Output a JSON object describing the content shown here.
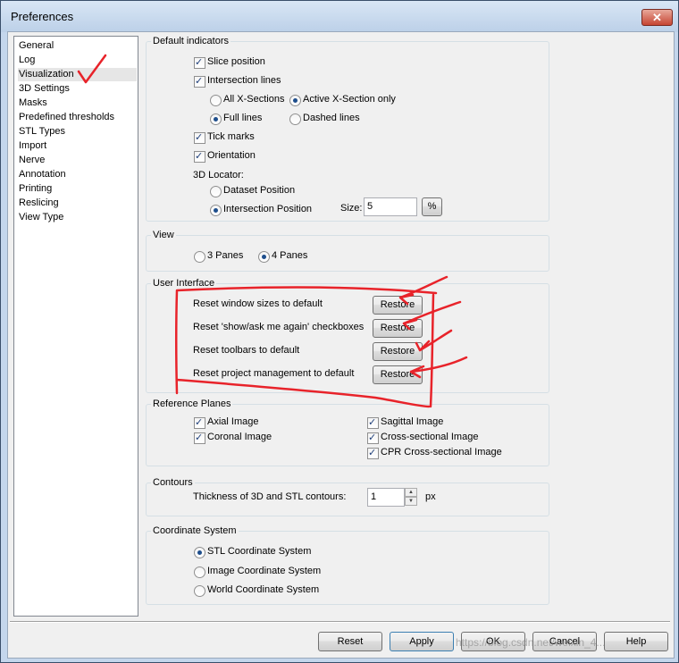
{
  "window": {
    "title": "Preferences",
    "close_symbol": "✕"
  },
  "nav": {
    "items": [
      "General",
      "Log",
      "Visualization",
      "3D Settings",
      "Masks",
      "Predefined thresholds",
      "STL Types",
      "Import",
      "Nerve",
      "Annotation",
      "Printing",
      "Reslicing",
      "View Type"
    ],
    "selected": "Visualization"
  },
  "default_indicators": {
    "title": "Default indicators",
    "slice_position": "Slice position",
    "intersection_lines": "Intersection lines",
    "all_x_sections": "All X-Sections",
    "active_x_section_only": "Active X-Section only",
    "full_lines": "Full lines",
    "dashed_lines": "Dashed lines",
    "tick_marks": "Tick marks",
    "orientation": "Orientation",
    "locator_label": "3D Locator:",
    "dataset_position": "Dataset Position",
    "intersection_position": "Intersection Position",
    "size_label": "Size:",
    "size_value": "5",
    "percent_button": "%"
  },
  "view": {
    "title": "View",
    "three_panes": "3 Panes",
    "four_panes": "4 Panes"
  },
  "user_interface": {
    "title": "User Interface",
    "rows": [
      {
        "label": "Reset window sizes to default",
        "button": "Restore"
      },
      {
        "label": "Reset 'show/ask me again' checkboxes",
        "button": "Restore"
      },
      {
        "label": "Reset toolbars to default",
        "button": "Restore"
      },
      {
        "label": "Reset project management to default",
        "button": "Restore"
      }
    ]
  },
  "reference_planes": {
    "title": "Reference Planes",
    "axial": "Axial Image",
    "coronal": "Coronal Image",
    "sagittal": "Sagittal Image",
    "cross_sectional": "Cross-sectional Image",
    "cpr_cross_sectional": "CPR Cross-sectional Image"
  },
  "contours": {
    "title": "Contours",
    "thickness_label": "Thickness of 3D and STL contours:",
    "thickness_value": "1",
    "unit": "px"
  },
  "coordinate_system": {
    "title": "Coordinate System",
    "stl": "STL Coordinate System",
    "image": "Image Coordinate System",
    "world": "World Coordinate System"
  },
  "footer": {
    "reset": "Reset",
    "apply": "Apply",
    "ok": "OK",
    "cancel": "Cancel",
    "help": "Help"
  },
  "watermark": "https://blog.csdn.net/weixin_4...",
  "colors": {
    "annotation": "#e8232a",
    "selection": "#1e4e8c"
  }
}
